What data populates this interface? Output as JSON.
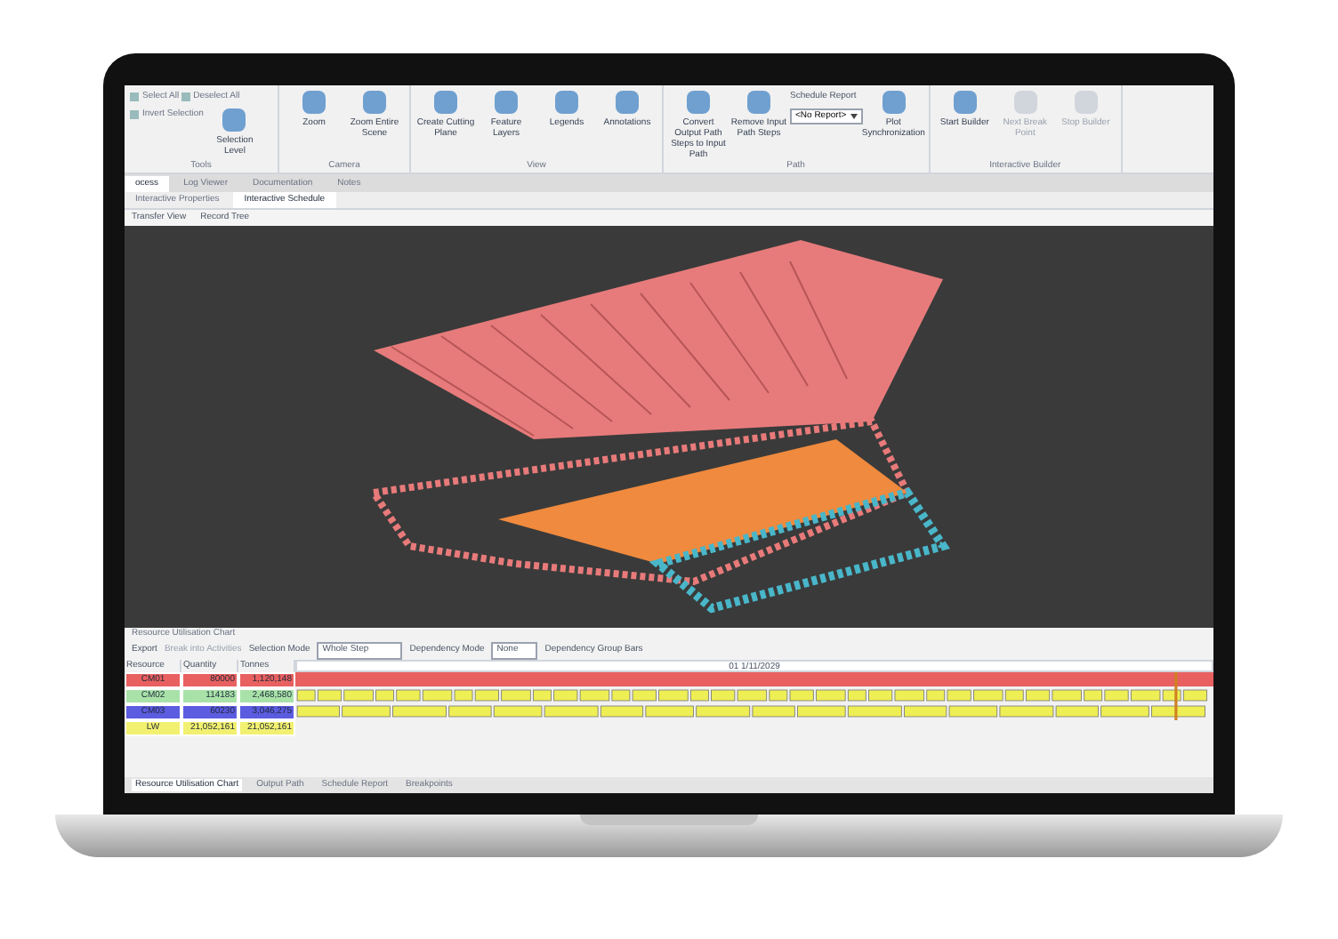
{
  "ribbon": {
    "groups": [
      {
        "label": "Tools",
        "items": [
          {
            "label": "Select All",
            "kind": "small"
          },
          {
            "label": "Deselect All",
            "kind": "small"
          },
          {
            "label": "Invert Selection",
            "kind": "small"
          },
          {
            "label": "Selection Level",
            "kind": "large"
          }
        ]
      },
      {
        "label": "Camera",
        "items": [
          {
            "label": "Zoom",
            "kind": "large"
          },
          {
            "label": "Zoom Entire Scene",
            "kind": "large"
          }
        ]
      },
      {
        "label": "View",
        "items": [
          {
            "label": "Create Cutting Plane",
            "kind": "large"
          },
          {
            "label": "Feature Layers",
            "kind": "large"
          },
          {
            "label": "Legends",
            "kind": "large"
          },
          {
            "label": "Annotations",
            "kind": "large"
          }
        ]
      },
      {
        "label": "Path",
        "items": [
          {
            "label": "Convert Output Path Steps to Input Path",
            "kind": "large"
          },
          {
            "label": "Remove Input Path Steps",
            "kind": "large"
          },
          {
            "label": "Schedule Report",
            "kind": "select",
            "value": "<No Report>"
          },
          {
            "label": "Plot Synchronization",
            "kind": "large"
          }
        ]
      },
      {
        "label": "Interactive Builder",
        "items": [
          {
            "label": "Start Builder",
            "kind": "large",
            "disabled": false
          },
          {
            "label": "Next Break Point",
            "kind": "large",
            "disabled": true
          },
          {
            "label": "Stop Builder",
            "kind": "large",
            "disabled": true
          }
        ]
      }
    ]
  },
  "doc_tabs": [
    {
      "label": "ocess",
      "selected": true
    },
    {
      "label": "Log Viewer",
      "selected": false
    },
    {
      "label": "Documentation",
      "selected": false
    },
    {
      "label": "Notes",
      "selected": false
    }
  ],
  "sub_tabs": [
    {
      "label": "Interactive Properties",
      "selected": false
    },
    {
      "label": "Interactive Schedule",
      "selected": true
    }
  ],
  "toolbar": [
    "Transfer View",
    "Record Tree"
  ],
  "chart_panel": {
    "title": "Resource Utilisation Chart",
    "toolbar": {
      "export": "Export",
      "break": "Break into Activities",
      "selection_label": "Selection Mode",
      "selection_value": "Whole Step",
      "dependency_label": "Dependency Mode",
      "dependency_value": "None",
      "group_bars": "Dependency Group Bars"
    },
    "columns": [
      "Resource",
      "Quantity",
      "Tonnes"
    ],
    "timeline_header": "01 1/11/2029",
    "rows": [
      {
        "resource": "CM01",
        "quantity": "80000",
        "tonnes": "1,120,148",
        "color": "#e86060",
        "kind": "solid"
      },
      {
        "resource": "CM02",
        "quantity": "114183",
        "tonnes": "2,468,580",
        "color": "#a8e2a8",
        "kind": "short"
      },
      {
        "resource": "CM03",
        "quantity": "60230",
        "tonnes": "3,046,275",
        "color": "#5c5ce0",
        "kind": "long"
      },
      {
        "resource": "LW",
        "quantity": "21,052,161",
        "tonnes": "21,052,161",
        "color": "#f2f070",
        "kind": "empty"
      }
    ]
  },
  "bottom_tabs": [
    {
      "label": "Resource Utilisation Chart",
      "selected": true
    },
    {
      "label": "Output Path",
      "selected": false
    },
    {
      "label": "Schedule Report",
      "selected": false
    },
    {
      "label": "Breakpoints",
      "selected": false
    }
  ]
}
